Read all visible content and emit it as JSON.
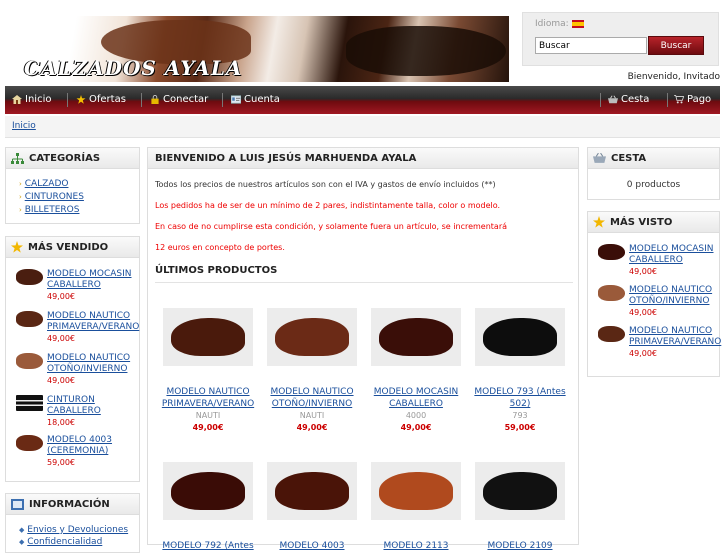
{
  "header": {
    "logo_text": "CALZADOS AYALA",
    "language_label": "Idioma:",
    "search_value": "Buscar",
    "search_button": "Buscar",
    "welcome": "Bienvenido, Invitado"
  },
  "nav": {
    "left": [
      {
        "label": "Inicio",
        "icon": "home-icon"
      },
      {
        "label": "Ofertas",
        "icon": "star-icon"
      },
      {
        "label": "Conectar",
        "icon": "lock-icon"
      },
      {
        "label": "Cuenta",
        "icon": "id-card-icon"
      }
    ],
    "right": [
      {
        "label": "Cesta",
        "icon": "basket-icon"
      },
      {
        "label": "Pago",
        "icon": "cart-icon"
      }
    ]
  },
  "breadcrumb": "Inicio",
  "categories": {
    "title": "CATEGORÍAS",
    "items": [
      "CALZADO",
      "CINTURONES",
      "BILLETEROS"
    ]
  },
  "best_sellers": {
    "title": "MÁS VENDIDO",
    "items": [
      {
        "name_line1": "MODELO MOCASIN",
        "name_line2": "CABALLERO",
        "price": "49,00€"
      },
      {
        "name_line1": "MODELO NAUTICO",
        "name_line2": "PRIMAVERA/VERANO",
        "price": "49,00€"
      },
      {
        "name_line1": "MODELO NAUTICO",
        "name_line2": "OTOÑO/INVIERNO",
        "price": "49,00€"
      },
      {
        "name_line1": "CINTURON",
        "name_line2": "CABALLERO",
        "price": "18,00€"
      },
      {
        "name_line1": "MODELO 4003",
        "name_line2": "(CEREMONIA)",
        "price": "59,00€"
      }
    ]
  },
  "information": {
    "title": "INFORMACIÓN",
    "items": [
      "Envios y Devoluciones",
      "Confidencialidad"
    ]
  },
  "main": {
    "title": "BIENVENIDO A LUIS JESÚS MARHUENDA AYALA",
    "p1": "Todos los precios de nuestros artículos son con el IVA y gastos de envío incluidos (**)",
    "p2": "Los pedidos ha de ser de un mínimo de 2 pares, indistintamente talla, color o modelo.",
    "p3": "En caso de no cumplirse esta condición, y solamente fuera un artículo, se incrementará",
    "p4": "12 euros en concepto de portes.",
    "latest_title": "ÚLTIMOS PRODUCTOS",
    "products": [
      {
        "name1": "MODELO NAUTICO",
        "name2": "PRIMAVERA/VERANO",
        "ref": "NAUTI",
        "price": "49,00€"
      },
      {
        "name1": "MODELO NAUTICO",
        "name2": "OTOÑO/INVIERNO",
        "ref": "NAUTI",
        "price": "49,00€"
      },
      {
        "name1": "MODELO MOCASIN",
        "name2": "CABALLERO",
        "ref": "4000",
        "price": "49,00€"
      },
      {
        "name1": "MODELO 793 (Antes",
        "name2": "502)",
        "ref": "793",
        "price": "59,00€"
      },
      {
        "name1": "MODELO 792 (Antes",
        "name2": "",
        "ref": "",
        "price": ""
      },
      {
        "name1": "MODELO 4003",
        "name2": "",
        "ref": "",
        "price": ""
      },
      {
        "name1": "MODELO 2113",
        "name2": "",
        "ref": "",
        "price": ""
      },
      {
        "name1": "MODELO 2109",
        "name2": "",
        "ref": "",
        "price": ""
      }
    ]
  },
  "cart": {
    "title": "CESTA",
    "text": "0 productos"
  },
  "most_viewed": {
    "title": "MÁS VISTO",
    "items": [
      {
        "name_line1": "MODELO MOCASIN",
        "name_line2": "CABALLERO",
        "price": "49,00€"
      },
      {
        "name_line1": "MODELO NAUTICO",
        "name_line2": "OTOÑO/INVIERNO",
        "price": "49,00€"
      },
      {
        "name_line1": "MODELO NAUTICO",
        "name_line2": "PRIMAVERA/VERANO",
        "price": "49,00€"
      }
    ]
  },
  "colors": {
    "accent": "#a01822",
    "link": "#1a4f9c",
    "price": "#cc0000"
  }
}
